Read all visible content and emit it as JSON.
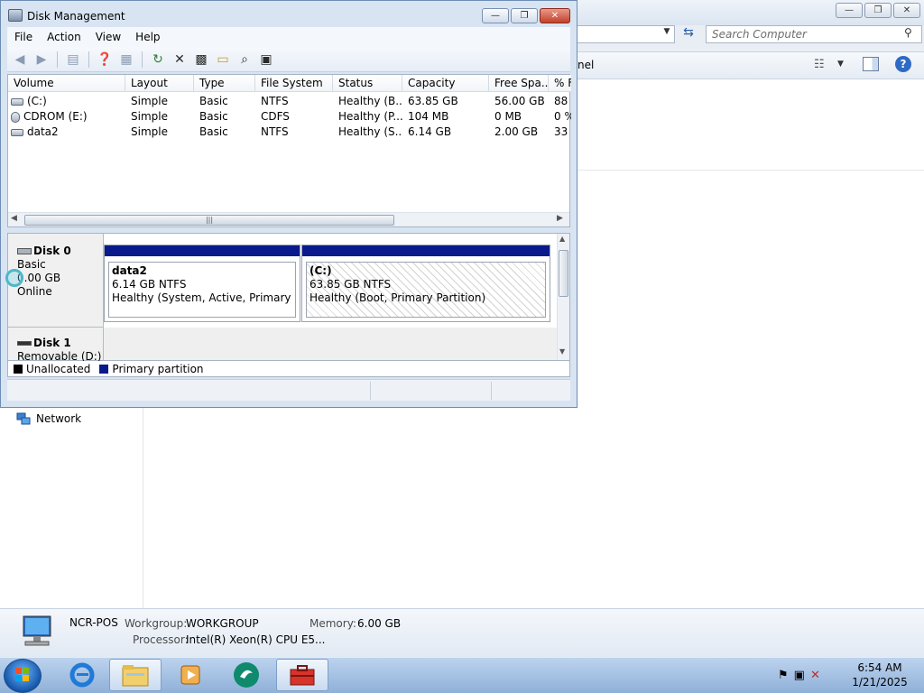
{
  "explorer": {
    "search_placeholder": "Search Computer",
    "cmd_text": "nel",
    "nav": {
      "network_label": "Network"
    },
    "details": {
      "computer_name": "NCR-POS",
      "workgroup_label": "Workgroup:",
      "workgroup_value": "WORKGROUP",
      "memory_label": "Memory:",
      "memory_value": "6.00 GB",
      "processor_label": "Processor:",
      "processor_value": "Intel(R) Xeon(R) CPU E5..."
    },
    "caption_buttons": {
      "minimize": "—",
      "maximize": "❐",
      "close": "✕"
    }
  },
  "disk_management": {
    "title": "Disk Management",
    "menu": [
      "File",
      "Action",
      "View",
      "Help"
    ],
    "columns": [
      "Volume",
      "Layout",
      "Type",
      "File System",
      "Status",
      "Capacity",
      "Free Spa...",
      "% F"
    ],
    "volumes": [
      {
        "volume": "(C:)",
        "layout": "Simple",
        "type": "Basic",
        "fs": "NTFS",
        "status": "Healthy (B...",
        "capacity": "63.85 GB",
        "free": "56.00 GB",
        "pct": "88"
      },
      {
        "volume": "CDROM (E:)",
        "layout": "Simple",
        "type": "Basic",
        "fs": "CDFS",
        "status": "Healthy (P...",
        "capacity": "104 MB",
        "free": "0 MB",
        "pct": "0 %"
      },
      {
        "volume": "data2",
        "layout": "Simple",
        "type": "Basic",
        "fs": "NTFS",
        "status": "Healthy (S...",
        "capacity": "6.14 GB",
        "free": "2.00 GB",
        "pct": "33"
      }
    ],
    "disk0": {
      "name": "Disk 0",
      "type": "Basic",
      "size": "0.00 GB",
      "state": "Online",
      "partitions": [
        {
          "name": "data2",
          "size": "6.14 GB NTFS",
          "status": "Healthy (System, Active, Primary Partit"
        },
        {
          "name": "(C:)",
          "size": "63.85 GB NTFS",
          "status": "Healthy (Boot, Primary Partition)"
        }
      ]
    },
    "disk1": {
      "name": "Disk 1",
      "type": "Removable (D:)"
    },
    "legend": {
      "unallocated": "Unallocated",
      "primary": "Primary partition"
    },
    "colors": {
      "unallocated": "#000000",
      "primary": "#0a1a8c"
    }
  },
  "taskbar": {
    "time": "6:54 AM",
    "date": "1/21/2025"
  }
}
